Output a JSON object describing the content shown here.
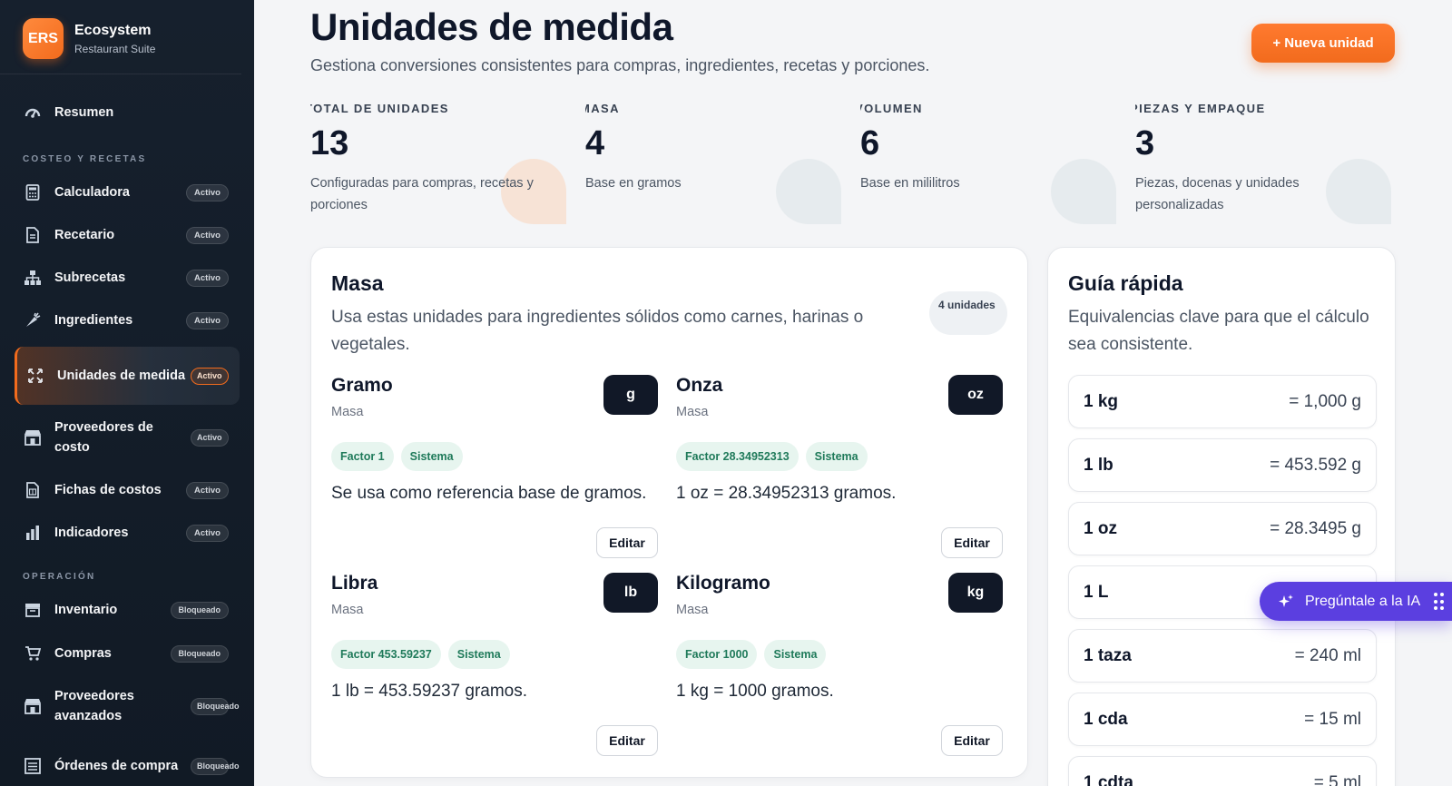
{
  "brand": {
    "logo": "ERS",
    "name": "Ecosystem",
    "subtitle": "Restaurant Suite"
  },
  "sidebar": {
    "summary": {
      "label": "Resumen",
      "icon": "gauge-icon"
    },
    "sections": [
      {
        "title": "COSTEO Y RECETAS"
      },
      {
        "title": "OPERACIÓN"
      }
    ],
    "items": [
      {
        "label": "Calculadora",
        "badge": "Activo",
        "icon": "calculator-icon"
      },
      {
        "label": "Recetario",
        "badge": "Activo",
        "icon": "document-icon"
      },
      {
        "label": "Subrecetas",
        "badge": "Activo",
        "icon": "hierarchy-icon"
      },
      {
        "label": "Ingredientes",
        "badge": "Activo",
        "icon": "carrot-icon"
      },
      {
        "label": "Unidades de medida",
        "badge": "Activo",
        "icon": "expand-arrows-icon",
        "active": true
      },
      {
        "label": "Proveedores de costo",
        "badge": "Activo",
        "icon": "store-icon"
      },
      {
        "label": "Fichas de costos",
        "badge": "Activo",
        "icon": "sheet-icon"
      },
      {
        "label": "Indicadores",
        "badge": "Activo",
        "icon": "bar-chart-icon"
      },
      {
        "label": "Inventario",
        "badge": "Bloqueado",
        "icon": "inbox-icon"
      },
      {
        "label": "Compras",
        "badge": "Bloqueado",
        "icon": "cart-icon"
      },
      {
        "label": "Proveedores avanzados",
        "badge": "Bloqueado",
        "icon": "store-icon"
      },
      {
        "label": "Órdenes de compra",
        "badge": "Bloqueado",
        "icon": "list-icon"
      }
    ]
  },
  "header": {
    "title": "Unidades de medida",
    "subtitle": "Gestiona conversiones consistentes para compras, ingredientes, recetas y porciones.",
    "new_button": "+ Nueva unidad"
  },
  "stats": [
    {
      "label": "TOTAL DE UNIDADES",
      "value": "13",
      "desc": "Configuradas para compras, recetas y porciones"
    },
    {
      "label": "MASA",
      "value": "4",
      "desc": "Base en gramos"
    },
    {
      "label": "VOLUMEN",
      "value": "6",
      "desc": "Base en mililitros"
    },
    {
      "label": "PIEZAS Y EMPAQUE",
      "value": "3",
      "desc": "Piezas, docenas y unidades personalizadas"
    }
  ],
  "mass_card": {
    "title": "Masa",
    "desc": "Usa estas unidades para ingredientes sólidos como carnes, harinas o vegetales.",
    "count": "4 unidades",
    "edit_label": "Editar",
    "units": [
      {
        "name": "Gramo",
        "category": "Masa",
        "symbol": "g",
        "factor": "Factor 1",
        "tag": "Sistema",
        "note": "Se usa como referencia base de gramos."
      },
      {
        "name": "Onza",
        "category": "Masa",
        "symbol": "oz",
        "factor": "Factor 28.34952313",
        "tag": "Sistema",
        "note": "1 oz = 28.34952313 gramos."
      },
      {
        "name": "Libra",
        "category": "Masa",
        "symbol": "lb",
        "factor": "Factor 453.59237",
        "tag": "Sistema",
        "note": "1 lb = 453.59237 gramos."
      },
      {
        "name": "Kilogramo",
        "category": "Masa",
        "symbol": "kg",
        "factor": "Factor 1000",
        "tag": "Sistema",
        "note": "1 kg = 1000 gramos."
      }
    ]
  },
  "guide_card": {
    "title": "Guía rápida",
    "desc": "Equivalencias clave para que el cálculo sea consistente.",
    "rows": [
      {
        "left": "1 kg",
        "right": "= 1,000 g"
      },
      {
        "left": "1 lb",
        "right": "= 453.592 g"
      },
      {
        "left": "1 oz",
        "right": "= 28.3495 g"
      },
      {
        "left": "1 L",
        "right": ""
      },
      {
        "left": "1 taza",
        "right": "= 240 ml"
      },
      {
        "left": "1 cda",
        "right": "= 15 ml"
      },
      {
        "left": "1 cdta",
        "right": "= 5 ml"
      }
    ]
  },
  "ai_button": {
    "label": "Pregúntale a la IA",
    "icon": "sparkle-icon"
  },
  "colors": {
    "accent": "#f26b1d",
    "sidebar": "#16202d",
    "ai": "#5b3fe0",
    "chip_bg": "#e7f5ef",
    "chip_text": "#1f7a5a"
  }
}
